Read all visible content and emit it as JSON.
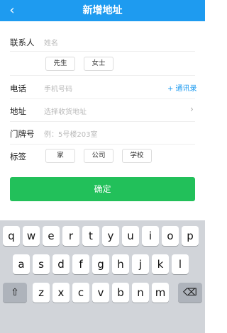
{
  "navbar": {
    "back_icon": "chevron-left-icon",
    "title": "新增地址"
  },
  "form": {
    "contact": {
      "label": "联系人",
      "placeholder": "姓名"
    },
    "gender": {
      "options": [
        "先生",
        "女士"
      ]
    },
    "phone": {
      "label": "电话",
      "placeholder": "手机号码",
      "address_book": "+ 通讯录"
    },
    "address": {
      "label": "地址",
      "placeholder": "选择收货地址",
      "chevron_icon": "chevron-right-icon"
    },
    "house_number": {
      "label": "门牌号",
      "placeholder": "例：5号楼203室"
    },
    "tags": {
      "label": "标签",
      "options": [
        "家",
        "公司",
        "学校"
      ]
    },
    "confirm_label": "确定"
  },
  "keyboard": {
    "row1": [
      "q",
      "w",
      "e",
      "r",
      "t",
      "y",
      "u",
      "i",
      "o",
      "p"
    ],
    "row2": [
      "a",
      "s",
      "d",
      "f",
      "g",
      "h",
      "j",
      "k",
      "l"
    ],
    "row3": [
      "z",
      "x",
      "c",
      "v",
      "b",
      "n",
      "m"
    ],
    "shift_icon": "shift-icon",
    "delete_icon": "backspace-icon"
  },
  "colors": {
    "accent": "#1e9bf0",
    "confirm_green": "#22c05a"
  }
}
